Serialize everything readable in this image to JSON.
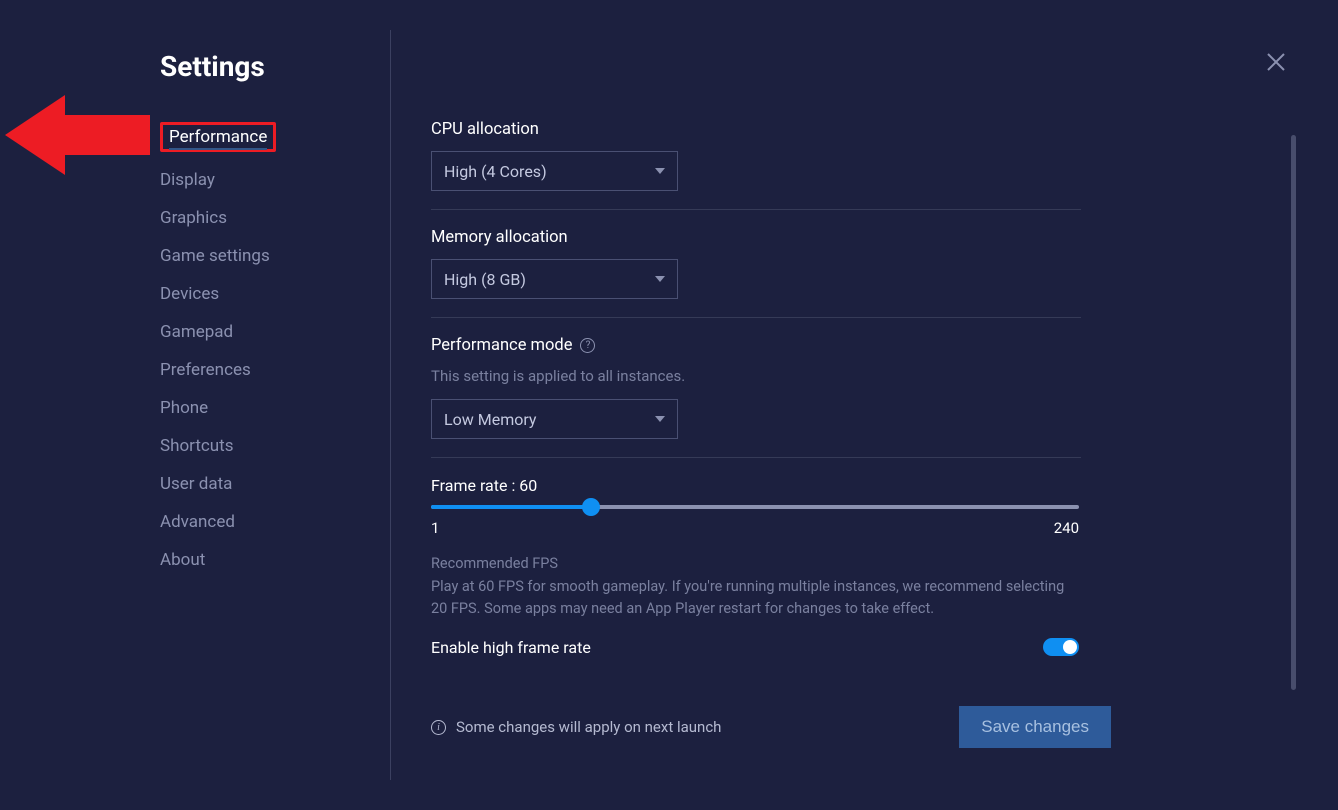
{
  "page_title": "Settings",
  "sidebar": {
    "items": [
      {
        "label": "Performance"
      },
      {
        "label": "Display"
      },
      {
        "label": "Graphics"
      },
      {
        "label": "Game settings"
      },
      {
        "label": "Devices"
      },
      {
        "label": "Gamepad"
      },
      {
        "label": "Preferences"
      },
      {
        "label": "Phone"
      },
      {
        "label": "Shortcuts"
      },
      {
        "label": "User data"
      },
      {
        "label": "Advanced"
      },
      {
        "label": "About"
      }
    ],
    "active_index": 0
  },
  "performance": {
    "cpu_label": "CPU allocation",
    "cpu_value": "High (4 Cores)",
    "mem_label": "Memory allocation",
    "mem_value": "High (8 GB)",
    "mode_label": "Performance mode",
    "mode_sub": "This setting is applied to all instances.",
    "mode_value": "Low Memory",
    "frame_label_prefix": "Frame rate : ",
    "frame_value": 60,
    "frame_min": 1,
    "frame_max": 240,
    "rec_title": "Recommended FPS",
    "rec_text": "Play at 60 FPS for smooth gameplay. If you're running multiple instances, we recommend selecting 20 FPS. Some apps may need an App Player restart for changes to take effect.",
    "high_fps_label": "Enable high frame rate",
    "high_fps_on": true
  },
  "footer": {
    "notice": "Some changes will apply on next launch",
    "save_label": "Save changes"
  }
}
